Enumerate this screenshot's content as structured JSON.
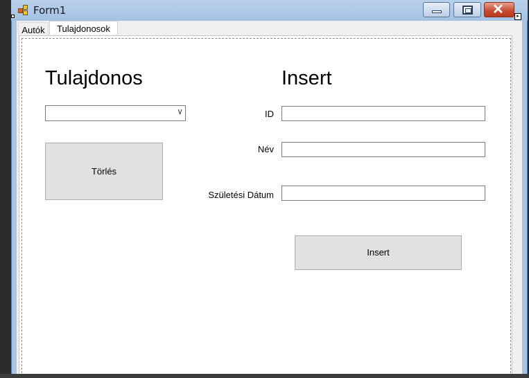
{
  "window": {
    "title": "Form1",
    "buttons": {
      "minimize": "minimize-icon",
      "maximize": "maximize-icon",
      "close": "close-icon"
    }
  },
  "tabs": [
    {
      "label": "Autók",
      "selected": false
    },
    {
      "label": "Tulajdonosok",
      "selected": true
    }
  ],
  "left_section": {
    "heading": "Tulajdonos",
    "combo_value": "",
    "delete_button": "Törlés"
  },
  "insert_section": {
    "heading": "Insert",
    "id_label": "ID",
    "id_value": "",
    "name_label": "Név",
    "name_value": "",
    "birth_label": "Születési Dátum",
    "birth_value": "",
    "insert_button": "Insert"
  },
  "colors": {
    "titlebar": "#a9c4e2",
    "close_button": "#c74a2f",
    "button_face": "#e1e1e1"
  }
}
